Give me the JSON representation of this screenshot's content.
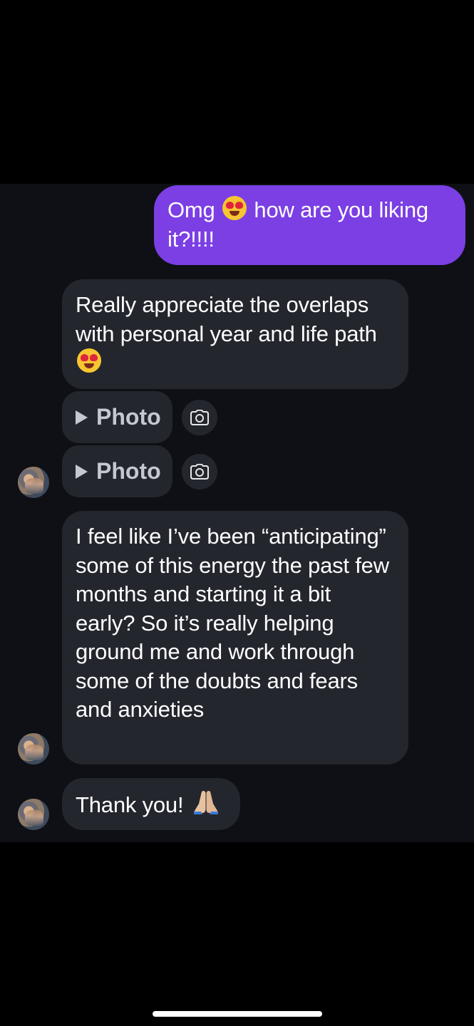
{
  "messages": {
    "outgoing_1": {
      "text_before_emoji": "Omg ",
      "emoji": "heart-eyes",
      "text_after_emoji": " how are you liking it?!!!!"
    },
    "incoming_1": {
      "text_before_emoji": "Really appreciate the overlaps with personal year and life path ",
      "emoji": "heart-eyes"
    },
    "photo_1": {
      "label": "Photo"
    },
    "photo_2": {
      "label": "Photo"
    },
    "incoming_2": {
      "text": "I feel like I’ve been “anticipating” some of this energy the past few months and starting it a bit early? So it’s really helping ground me and work through some of the doubts and fears and anxieties"
    },
    "incoming_3": {
      "text_before_emoji": "Thank you! ",
      "emoji": "folded-hands"
    }
  },
  "colors": {
    "outgoing_bubble": "#7b3fe4",
    "incoming_bubble": "#24262e",
    "chat_background": "#0e1015",
    "photo_label": "#c6c8cf"
  }
}
